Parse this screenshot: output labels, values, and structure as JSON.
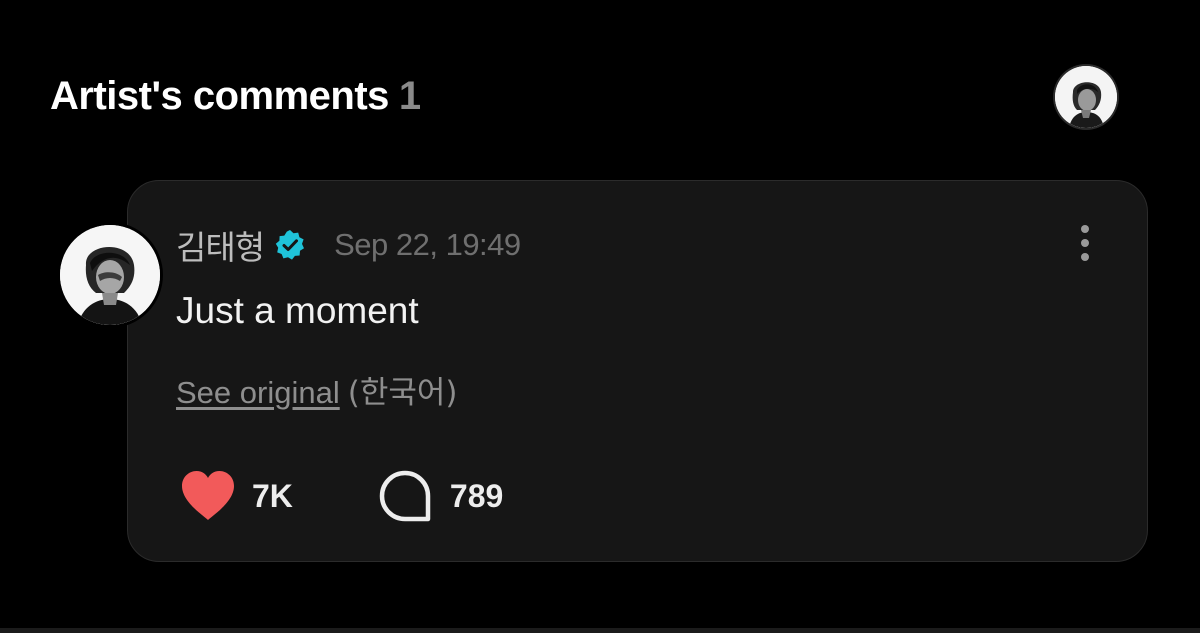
{
  "section": {
    "title": "Artist's comments",
    "count": "1"
  },
  "comment": {
    "author_name": "김태형",
    "verified_icon": "verified-badge-icon",
    "timestamp": "Sep 22, 19:49",
    "text": "Just a moment",
    "translation": {
      "see_original_label": "See original",
      "language_label": "(한국어)"
    },
    "likes": "7K",
    "replies": "789",
    "menu_icon": "more-vertical-icon"
  },
  "colors": {
    "background": "#000000",
    "card_background": "#161616",
    "verified": "#1fc3d9",
    "like": "#f25a5a",
    "muted_text": "#8e8e8e"
  }
}
